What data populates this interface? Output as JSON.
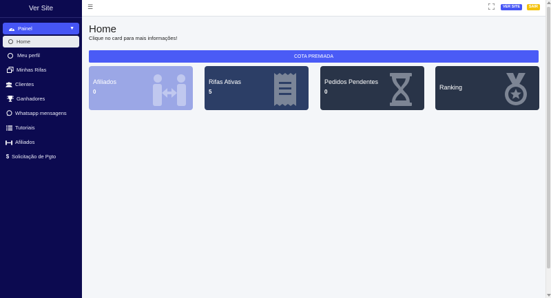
{
  "sidebar": {
    "brand": "Ver Site",
    "active_item": "Painel",
    "sub_item": "Home",
    "items": [
      {
        "label": "Meu perfil"
      },
      {
        "label": "Minhas Rifas"
      },
      {
        "label": "Clientes"
      },
      {
        "label": "Ganhadores"
      },
      {
        "label": "Whatsapp mensagens"
      },
      {
        "label": "Tutoriais"
      },
      {
        "label": "Afiliados"
      },
      {
        "label": "Solicitação de Pgto"
      }
    ]
  },
  "topbar": {
    "ver_site": "VER SITE",
    "sair": "SAIR"
  },
  "main": {
    "title": "Home",
    "subtitle": "Clique no card para mais informações!",
    "banner": "COTA PREMIADA",
    "cards": [
      {
        "title": "Afiliados",
        "value": "0"
      },
      {
        "title": "Rifas Ativas",
        "value": "5"
      },
      {
        "title": "Pedidos Pendentes",
        "value": "0"
      },
      {
        "title": "Ranking",
        "value": ""
      }
    ]
  },
  "colors": {
    "sidebar_bg": "#0c0a50",
    "accent": "#4655f5",
    "card_afiliados": "#9ba7e6",
    "card_rifas": "#2c3e66",
    "card_dark": "#293448",
    "sair_button": "#f4c20d"
  },
  "icons": {
    "painel": "dashboard-icon",
    "home": "circle-icon",
    "perfil": "circle-icon",
    "rifas": "clone-icon",
    "clientes": "users-icon",
    "ganhadores": "trophy-icon",
    "whatsapp": "whatsapp-icon",
    "tutoriais": "list-icon",
    "afiliados": "people-arrows-icon",
    "solicitacao": "dollar-icon"
  }
}
